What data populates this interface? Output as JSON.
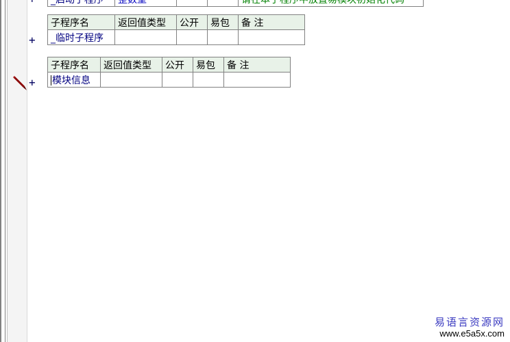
{
  "top_row": {
    "name": "_启动子程序",
    "type": "整数型",
    "note": "请在本子程序中放置易模块初始化代码"
  },
  "table1": {
    "headers": [
      "子程序名",
      "返回值类型",
      "公开",
      "易包",
      "备 注"
    ],
    "row": {
      "name": "_临时子程序",
      "type": "",
      "public": "",
      "package": "",
      "note": ""
    }
  },
  "table2": {
    "headers": [
      "子程序名",
      "返回值类型",
      "公开",
      "易包",
      "备 注"
    ],
    "row": {
      "name": "模块信息",
      "type": "",
      "public": "",
      "package": "",
      "note": ""
    }
  },
  "gutter": {
    "plus_symbol": "+",
    "edit_icon": "pencil-icon"
  },
  "watermark": {
    "title": "易语言资源网",
    "url": "www.e5a5x.com"
  },
  "colors": {
    "header_bg": "#e8f2e8",
    "grid_line": "#808080",
    "name_text": "#000080",
    "type_text": "#0000c0",
    "note_text": "#008000",
    "watermark_title": "#3a3ac0"
  }
}
